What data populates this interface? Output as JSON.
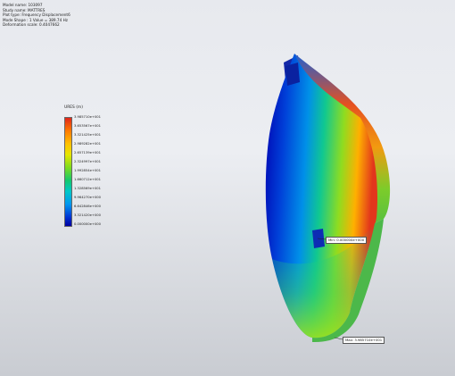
{
  "header": {
    "lines": [
      "Model name: 103097",
      "Study name: MATTRES",
      "Plot type: Frequency Displacement6",
      "Mode Shape : 1  Value =     389.74 Hz",
      "Deformation scale: 0.4047662"
    ]
  },
  "legend": {
    "title": "URES (m)",
    "ticks": [
      "3.985710e+001",
      "3.653567e+001",
      "3.321425e+001",
      "2.989282e+001",
      "2.657139e+001",
      "2.324997e+001",
      "1.992854e+001",
      "1.660712e+001",
      "1.328569e+001",
      "9.964270e+000",
      "6.642846e+000",
      "3.321420e+000",
      "0.000000e+000"
    ]
  },
  "callouts": {
    "min": "Min: 0.000000e+000",
    "max": "Max: 3.985710e+001"
  },
  "colors": {
    "low": "#0000a0",
    "high": "#e0261b"
  }
}
